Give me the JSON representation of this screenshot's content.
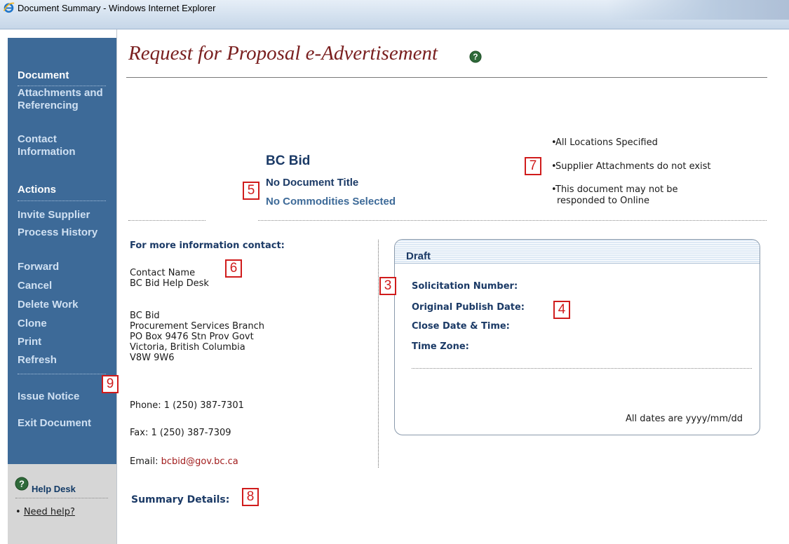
{
  "window": {
    "title": "Document Summary - Windows Internet Explorer"
  },
  "sidebar": {
    "sections": {
      "document": "Document",
      "attachments": "Attachments and Referencing",
      "contact": "Contact Information",
      "actions": "Actions"
    },
    "actions": [
      "Invite Supplier",
      "Process History",
      "Forward",
      "Cancel",
      "Delete Work",
      "Clone",
      "Print",
      "Refresh"
    ],
    "issue_notice": "Issue Notice",
    "exit_document": "Exit Document",
    "help_desk": "Help Desk",
    "need_help": "Need help?"
  },
  "page": {
    "title": "Request for Proposal e-Advertisement",
    "summary": {
      "org": "BC Bid",
      "doc_title": "No Document Title",
      "commodities": "No Commodities Selected"
    },
    "notes": [
      "All Locations Specified",
      "Supplier Attachments do not exist",
      "This document may not be",
      "responded to Online"
    ]
  },
  "contact": {
    "heading": "For more information contact:",
    "name_label": "Contact Name",
    "name": "BC Bid Help Desk",
    "org": "BC Bid",
    "branch": "Procurement Services Branch",
    "po_box": "PO Box 9476 Stn Prov Govt",
    "city": "Victoria, British Columbia",
    "postal": "V8W 9W6",
    "phone": "Phone: 1 (250) 387-7301",
    "fax": "Fax: 1 (250) 387-7309",
    "email_label": "Email: ",
    "email": "bcbid@gov.bc.ca"
  },
  "summary_details": "Summary Details:",
  "draft": {
    "label": "Draft",
    "solicitation": "Solicitation Number:",
    "publish_date": "Original Publish Date:",
    "close_date": "Close Date & Time:",
    "time_zone": "Time Zone:",
    "dates_note": "All dates are yyyy/mm/dd"
  },
  "markers": {
    "m3": "3",
    "m4": "4",
    "m5": "5",
    "m6": "6",
    "m7": "7",
    "m8": "8",
    "m9": "9"
  },
  "colors": {
    "nav_bg": "#3d6a98",
    "title_red": "#7a2020",
    "heading_blue": "#1b3a66",
    "marker_red": "#d01c1c"
  }
}
